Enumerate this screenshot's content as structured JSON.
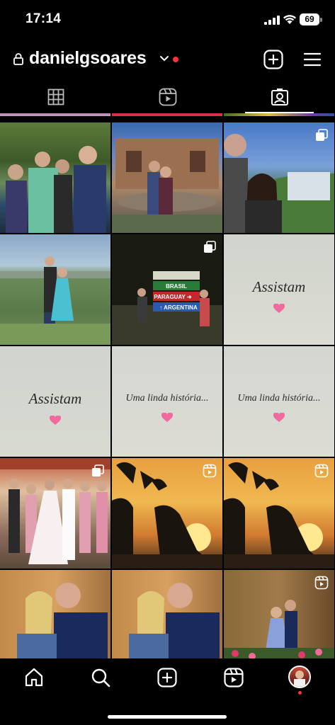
{
  "status_bar": {
    "time": "17:14",
    "battery": "69"
  },
  "header": {
    "username": "danielgsoares"
  },
  "icons": {
    "tabs": [
      "grid-icon",
      "reels-icon",
      "tagged-icon"
    ],
    "nav": [
      "home-icon",
      "search-icon",
      "create-icon",
      "reels-icon",
      "profile-avatar"
    ]
  },
  "grid": {
    "captions": {
      "assistam": "Assistam",
      "historia": "Uma linda história..."
    }
  },
  "colors": {
    "notification": "#ff3040",
    "text_card_bg": "#d8dbd6",
    "background": "#000000"
  }
}
